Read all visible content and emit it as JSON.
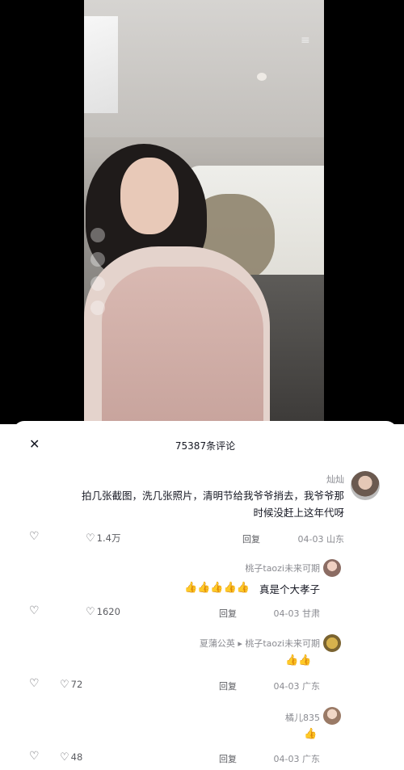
{
  "video": {
    "menu_icon": "hamburger-icon"
  },
  "comments_panel": {
    "title": "75387条评论",
    "close_label": "✕",
    "comments": [
      {
        "username": "灿灿",
        "text_line1": "拍几张截图，洗几张照片，清明节给我爷爷捎去，我爷爷那",
        "text_line2": "时候没赶上这年代呀",
        "meta": "04-03 山东",
        "reply": "回复",
        "likes": "1.4万"
      },
      {
        "username": "桃子taozi未来可期",
        "text": "真是个大孝子",
        "emoji": "👍👍👍👍👍",
        "meta": "04-03 甘肃",
        "reply": "回复",
        "likes": "1620"
      },
      {
        "username": "夏蒲公英 ▸ 桃子taozi未来可期",
        "emoji": "👍👍",
        "meta": "04-03 广东",
        "reply": "回复",
        "likes": "72"
      },
      {
        "username": "橘儿835",
        "emoji": "👍",
        "meta": "04-03 广东",
        "reply": "回复",
        "likes": "48"
      }
    ]
  }
}
